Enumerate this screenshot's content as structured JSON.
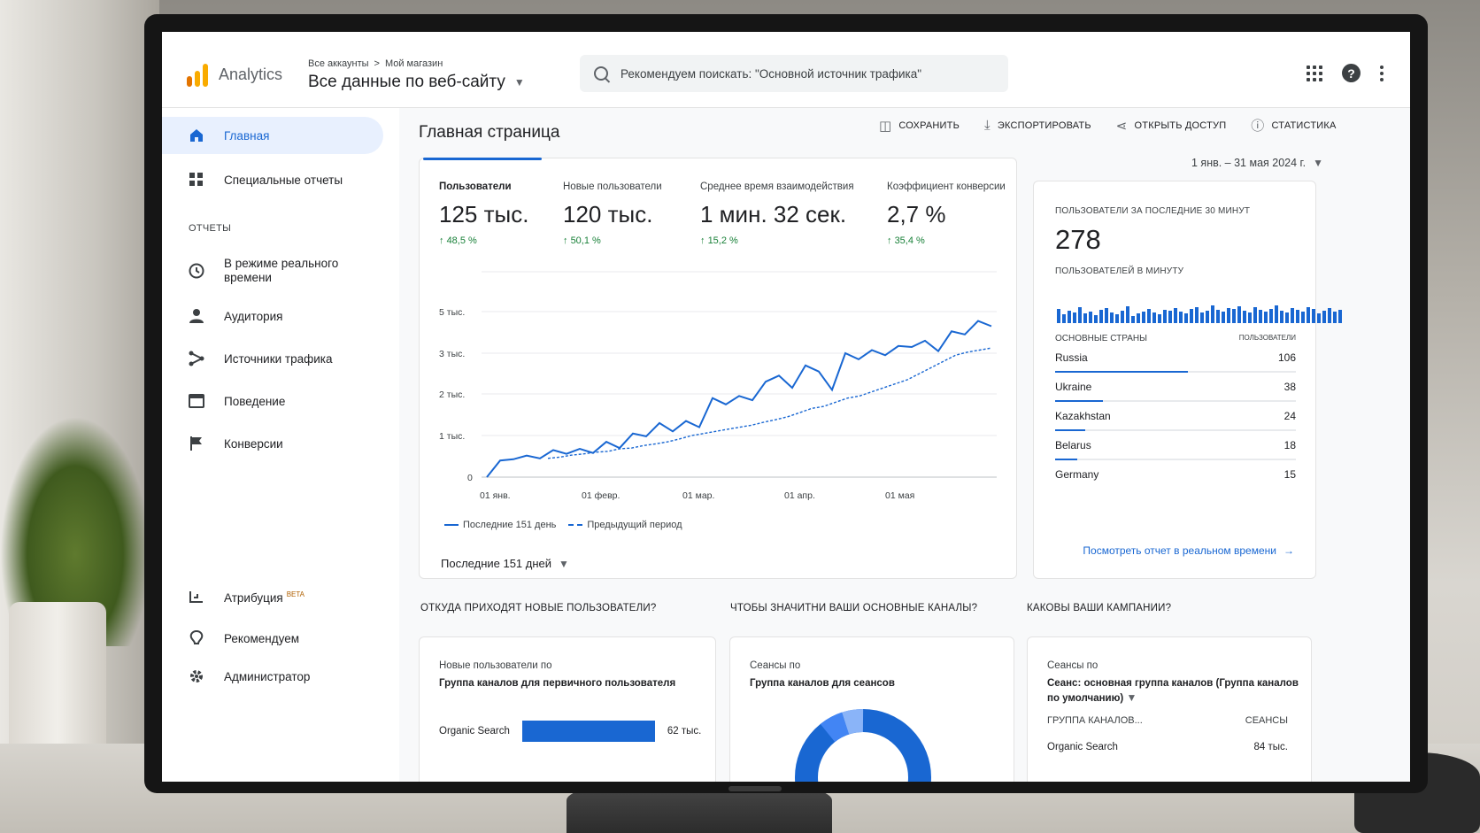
{
  "header": {
    "logo_text": "Analytics",
    "breadcrumb": [
      "Все аккаунты",
      ">",
      "Мой магазин"
    ],
    "property_title": "Все данные по веб-сайту",
    "search_placeholder": "Рекомендуем поискать: \"Основной источник трафика\""
  },
  "sidebar": {
    "items": [
      {
        "label": "Главная",
        "icon": "home-icon"
      },
      {
        "label": "Специальные отчеты",
        "icon": "grid-icon"
      }
    ],
    "section_label": "ОТЧЕТЫ",
    "report_items": [
      {
        "label": "В режиме реального времени",
        "icon": "clock-icon"
      },
      {
        "label": "Аудитория",
        "icon": "person-icon"
      },
      {
        "label": "Источники трафика",
        "icon": "source-icon"
      },
      {
        "label": "Поведение",
        "icon": "behavior-icon"
      },
      {
        "label": "Конверсии",
        "icon": "flag-icon"
      }
    ],
    "bottom_items": [
      {
        "label": "Атрибуция",
        "badge": "BETA",
        "icon": "attribution-icon"
      },
      {
        "label": "Рекомендуем",
        "icon": "lightbulb-icon"
      },
      {
        "label": "Администратор",
        "icon": "gear-icon"
      }
    ]
  },
  "main": {
    "page_title": "Главная страница",
    "toolbar": {
      "save": "СОХРАНИТЬ",
      "export": "ЭКСПОРТИРОВАТЬ",
      "share": "ОТКРЫТЬ ДОСТУП",
      "stats": "СТАТИСТИКА"
    },
    "date_range": "1 янв. – 31 мая 2024 г.",
    "metrics": [
      {
        "label": "Пользователи",
        "value": "125 тыс.",
        "delta": "48,5 %"
      },
      {
        "label": "Новые пользователи",
        "value": "120 тыс.",
        "delta": "50,1 %"
      },
      {
        "label": "Среднее время взаимодействия",
        "value": "1 мин. 32 сек.",
        "delta": "15,2 %"
      },
      {
        "label": "Коэффициент конверсии",
        "value": "2,7 %",
        "delta": "35,4 %"
      }
    ],
    "legend": {
      "current": "Последние 151 день",
      "previous": "Предыдущий период"
    },
    "period_selector": "Последние 151 дней"
  },
  "chart_data": {
    "type": "line",
    "y_ticks": [
      "0",
      "1 тыс.",
      "2 тыс.",
      "3 тыс.",
      "5 тыс."
    ],
    "x_ticks": [
      "01 янв.",
      "01 февр.",
      "01 мар.",
      "01 апр.",
      "01 мая"
    ],
    "series": [
      {
        "name": "Последние 151 день",
        "style": "solid",
        "values": [
          0,
          400,
          430,
          520,
          450,
          650,
          560,
          680,
          580,
          850,
          700,
          1050,
          980,
          1300,
          1100,
          1350,
          1200,
          1900,
          1750,
          1950,
          1850,
          2300,
          2450,
          2150,
          2700,
          2550,
          2100,
          3000,
          2850,
          3150,
          2950,
          3350,
          3300,
          3600,
          3100,
          4050,
          3900,
          4550,
          4300
        ]
      },
      {
        "name": "Предыдущий период",
        "style": "dashed",
        "values": [
          450,
          480,
          530,
          560,
          600,
          620,
          680,
          700,
          760,
          800,
          850,
          920,
          1000,
          1050,
          1100,
          1150,
          1200,
          1250,
          1320,
          1380,
          1450,
          1550,
          1650,
          1700,
          1800,
          1900,
          1950,
          2050,
          2150,
          2250,
          2350,
          2500,
          2650,
          2800,
          2950,
          3050,
          3150,
          3250
        ]
      }
    ]
  },
  "realtime": {
    "title": "ПОЛЬЗОВАТЕЛИ ЗА ПОСЛЕДНИЕ 30 МИНУТ",
    "value": "278",
    "subtitle": "ПОЛЬЗОВАТЕЛЕЙ В МИНУТУ",
    "head_left": "ОСНОВНЫЕ СТРАНЫ",
    "head_right": "ПОЛЬЗОВАТЕЛИ",
    "countries": [
      {
        "name": "Russia",
        "value": "106",
        "share": 1.0
      },
      {
        "name": "Ukraine",
        "value": "38",
        "share": 0.36
      },
      {
        "name": "Kazakhstan",
        "value": "24",
        "share": 0.23
      },
      {
        "name": "Belarus",
        "value": "18",
        "share": 0.17
      },
      {
        "name": "Germany",
        "value": "15",
        "share": 0.14
      }
    ],
    "link": "Посмотреть отчет в реальном времени"
  },
  "bottom": {
    "q1": "ОТКУДА ПРИХОДЯТ НОВЫЕ ПОЛЬЗОВАТЕЛИ?",
    "q2": "ЧТОБЫ ЗНАЧИТНИ ВАШИ ОСНОВНЫЕ КАНАЛЫ?",
    "q3": "КАКОВЫ ВАШИ КАМПАНИИ?",
    "card1": {
      "title": "Новые пользователи по",
      "subtitle": "Группа каналов для первичного пользователя",
      "bar_label": "Organic Search",
      "bar_value": "62 тыс."
    },
    "card2": {
      "title": "Сеансы по",
      "subtitle": "Группа каналов для сеансов"
    },
    "card3": {
      "title": "Сеансы по",
      "subtitle": "Сеанс: основная группа каналов (Группа каналов по умолчанию)",
      "col1": "ГРУППА КАНАЛОВ...",
      "col2": "СЕАНСЫ",
      "row_label": "Organic Search",
      "row_value": "84 тыс."
    }
  },
  "colors": {
    "accent": "#1967d2",
    "positive": "#188038",
    "logo_orange": "#f9ab00"
  }
}
